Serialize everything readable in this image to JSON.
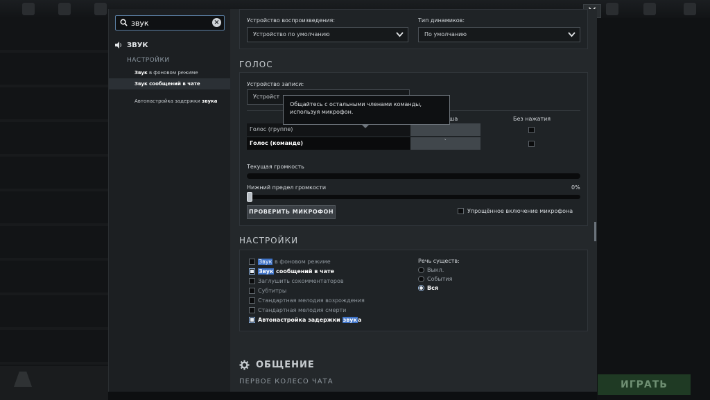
{
  "search": {
    "value": "звук"
  },
  "sidebar": {
    "section": "ЗВУК",
    "sub": "НАСТРОЙКИ",
    "links": [
      {
        "hl": "Звук",
        "rest": " в фоновом режиме"
      },
      {
        "hl": "Звук",
        "rest": " сообщений в чате"
      },
      {
        "pre": "Автонастройка задержки ",
        "hl": "звука"
      }
    ]
  },
  "playback": {
    "device_label": "Устройство воспроизведения:",
    "device_value": "Устройство по умолчанию",
    "speaker_label": "Тип динамиков:",
    "speaker_value": "По умолчанию"
  },
  "voice": {
    "title": "ГОЛОС",
    "record_label": "Устройство записи:",
    "record_value": "Устройст",
    "tooltip": "Общайтесь с остальными членами команды, используя микрофон.",
    "col_key_partial": "ша",
    "col_nopress": "Без нажатия",
    "row_group": "Голос (группе)",
    "row_team": "Голос (команде)",
    "team_key": "`",
    "current_volume": "Текущая громкость",
    "min_volume": "Нижний предел громкости",
    "min_volume_value": "0%",
    "mic_button": "ПРОВЕРИТЬ МИКРОФОН",
    "simple_mic": "Упрощённое включение микрофона"
  },
  "settings": {
    "title": "НАСТРОЙКИ",
    "options": [
      {
        "hl": "Звук",
        "rest": " в фоновом режиме",
        "checked": false
      },
      {
        "hl": "Звук",
        "rest": " сообщений в чате",
        "checked": true
      },
      {
        "rest": "Заглушить сокомментаторов",
        "checked": false
      },
      {
        "rest": "Субтитры",
        "checked": false
      },
      {
        "rest": "Стандартная мелодия возрождения",
        "checked": false
      },
      {
        "rest": "Стандартная мелодия смерти",
        "checked": false
      },
      {
        "pre": "Автонастройка задержки ",
        "hl": "звук",
        "post": "а",
        "checked": true
      }
    ],
    "speech_label": "Речь существ:",
    "speech_options": [
      "Выкл.",
      "События",
      "Вся"
    ],
    "speech_selected": "Вся"
  },
  "communication": {
    "title": "ОБЩЕНИЕ",
    "subtitle": "ПЕРВОЕ КОЛЕСО ЧАТА"
  },
  "play_button": "ИГРАТЬ",
  "close_button": "×"
}
